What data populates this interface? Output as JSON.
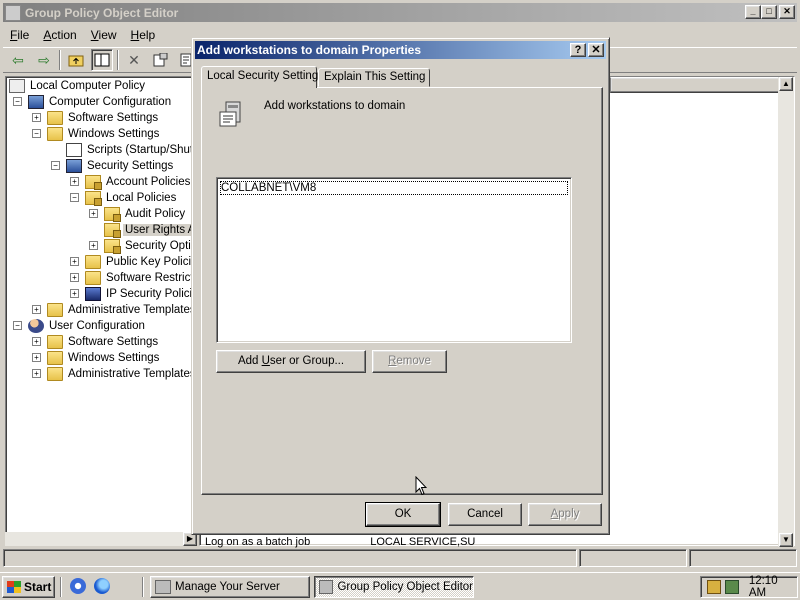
{
  "main_window": {
    "title": "Group Policy Object Editor",
    "controls": {
      "minimize": "_",
      "maximize": "□",
      "close": "✕"
    },
    "menu": [
      {
        "access_key": "F",
        "rest": "ile"
      },
      {
        "access_key": "A",
        "rest": "ction"
      },
      {
        "access_key": "V",
        "rest": "iew"
      },
      {
        "access_key": "H",
        "rest": "elp"
      }
    ],
    "toolbar_icons": [
      "back-arrow-icon",
      "forward-arrow-icon",
      "up-folder-icon",
      "show-hide-tree-icon",
      "delete-icon",
      "properties-icon",
      "export-list-icon"
    ]
  },
  "tree": {
    "nodes": [
      {
        "label": "Local Computer Policy",
        "icon": "policy-icon"
      },
      {
        "label": "Computer Configuration",
        "icon": "computer-icon",
        "expander": "−"
      },
      {
        "label": "Software Settings",
        "icon": "folder-icon",
        "expander": "+"
      },
      {
        "label": "Windows Settings",
        "icon": "folder-icon",
        "expander": "−"
      },
      {
        "label": "Scripts (Startup/Shutdown)",
        "icon": "scripts-icon"
      },
      {
        "label": "Security Settings",
        "icon": "security-settings-icon",
        "expander": "−"
      },
      {
        "label": "Account Policies",
        "icon": "locked-folder-icon",
        "expander": "+"
      },
      {
        "label": "Local Policies",
        "icon": "locked-folder-icon",
        "expander": "−"
      },
      {
        "label": "Audit Policy",
        "icon": "locked-folder-icon",
        "expander": "+"
      },
      {
        "label": "User Rights Assignment",
        "icon": "locked-folder-icon"
      },
      {
        "label": "Security Options",
        "icon": "locked-folder-icon",
        "expander": "+"
      },
      {
        "label": "Public Key Policies",
        "icon": "folder-icon",
        "expander": "+"
      },
      {
        "label": "Software Restriction Policies",
        "icon": "folder-icon",
        "expander": "+"
      },
      {
        "label": "IP Security Policies",
        "icon": "ipsec-icon",
        "expander": "+"
      },
      {
        "label": "Administrative Templates",
        "icon": "folder-icon",
        "expander": "+"
      },
      {
        "label": "User Configuration",
        "icon": "users-icon",
        "expander": "−"
      },
      {
        "label": "Software Settings",
        "icon": "folder-icon",
        "expander": "+"
      },
      {
        "label": "Windows Settings",
        "icon": "folder-icon",
        "expander": "+"
      },
      {
        "label": "Administrative Templates",
        "icon": "folder-icon",
        "expander": "+"
      }
    ]
  },
  "right_pane": {
    "visible_row": {
      "policy": "Log on as a batch job",
      "setting": "LOCAL SERVICE,SU"
    }
  },
  "dialog": {
    "title": "Add workstations to domain Properties",
    "help_btn": "?",
    "close_btn": "✕",
    "tabs": [
      {
        "label": "Local Security Setting",
        "active": true
      },
      {
        "label": "Explain This Setting",
        "active": false
      }
    ],
    "policy_name": "Add workstations to domain",
    "list_items": [
      "COLLABNET\\VM8"
    ],
    "add_button": {
      "before": "Add ",
      "access_key": "U",
      "after": "ser or Group..."
    },
    "remove_button": {
      "before": "",
      "access_key": "R",
      "after": "emove"
    },
    "ok_label": "OK",
    "cancel_label": "Cancel",
    "apply_button": {
      "before": "",
      "access_key": "A",
      "after": "pply"
    }
  },
  "taskbar": {
    "start_label": "Start",
    "tasks": [
      {
        "label": "Manage Your Server",
        "pressed": false
      },
      {
        "label": "Group Policy Object Editor",
        "pressed": true
      }
    ],
    "clock": "12:10 AM"
  }
}
